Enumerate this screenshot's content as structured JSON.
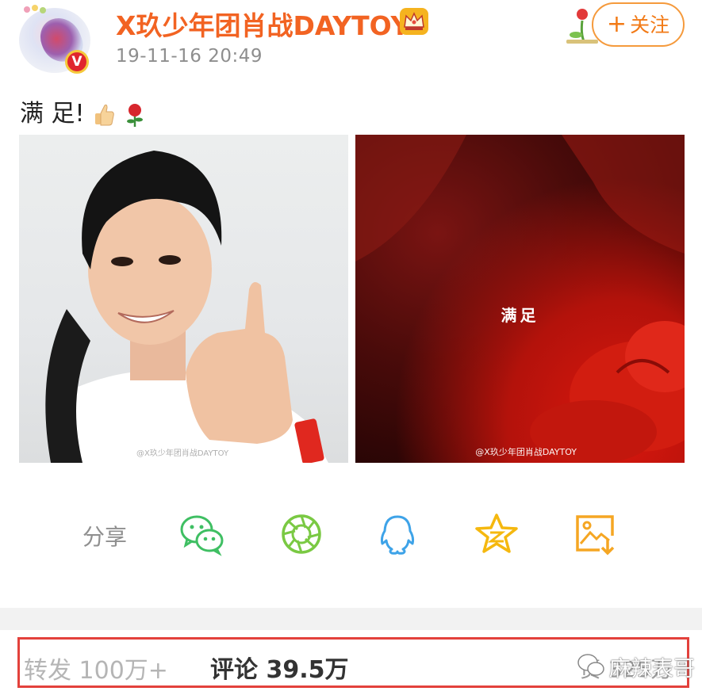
{
  "header": {
    "username": "X玖少年团肖战DAYTOY",
    "timestamp": "19-11-16 20:49",
    "verified_badge": "V",
    "follow_label": "关注",
    "follow_plus": "+"
  },
  "post": {
    "text": "满 足!",
    "emojis": [
      "thumbs-up-emoji",
      "rose-emoji"
    ]
  },
  "photos": [
    {
      "watermark": "@X玖少年团肖战DAYTOY"
    },
    {
      "caption": "满足",
      "watermark": "@X玖少年团肖战DAYTOY"
    }
  ],
  "share": {
    "label": "分享",
    "icons": [
      "wechat-icon",
      "moments-icon",
      "qq-icon",
      "qzone-icon",
      "save-image-icon"
    ]
  },
  "stats": {
    "repost": "转发 100万+",
    "comment": "评论 39.5万",
    "like_partial": "赞 325万"
  },
  "overlay_watermark": "麻辣表哥",
  "colors": {
    "username": "#f26322",
    "follow_border": "#f59a3c",
    "highlight_box": "#e3413c",
    "wechat": "#3fbf63",
    "moments": "#7ac943",
    "qq": "#3ea3e8",
    "qzone": "#f5b80f",
    "save": "#f5a623"
  }
}
